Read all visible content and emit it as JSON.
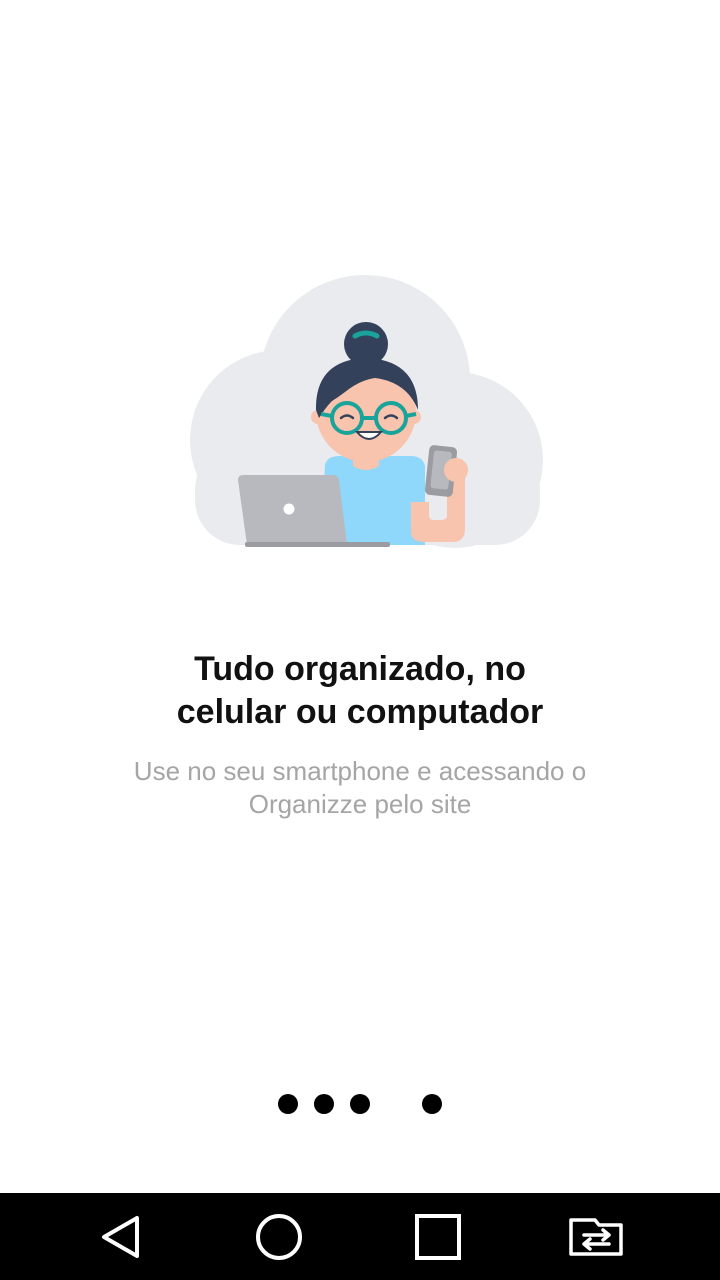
{
  "onboarding": {
    "title": "Tudo organizado, no\ncelular ou computador",
    "subtitle": "Use no seu smartphone e acessando o\nOrganizze pelo site",
    "illustration_icon": "person-with-laptop-and-phone-illustration",
    "pager": {
      "total_dots": 4,
      "current_page": 4,
      "dot_color": "#000000"
    }
  },
  "colors": {
    "background": "#ffffff",
    "title": "#111111",
    "subtitle": "#a5a5a5",
    "cloud": "#e9ebef",
    "shirt": "#8fd8fb",
    "hair": "#34415a",
    "glasses": "#1aa39a",
    "skin": "#f9c4ad",
    "laptop": "#b7b9be",
    "navbar": "#000000"
  },
  "navbar": {
    "buttons": [
      "back-icon",
      "home-icon",
      "recents-icon",
      "switch-apps-icon"
    ]
  }
}
